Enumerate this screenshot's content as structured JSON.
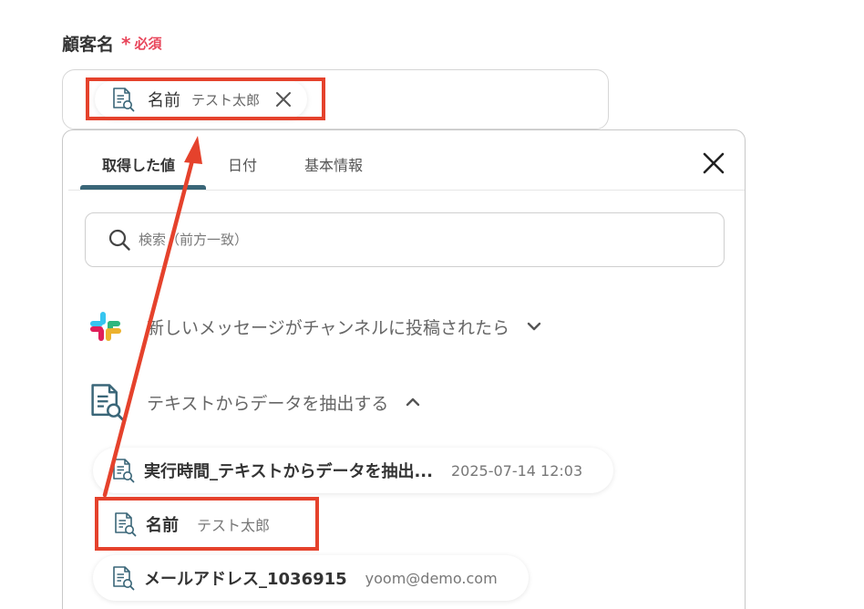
{
  "field": {
    "label": "顧客名",
    "required_star": "*",
    "required_text": "必須",
    "selected_chip": {
      "name": "名前",
      "value": "テスト太郎",
      "icon": "document-search-icon"
    }
  },
  "panel": {
    "tabs": [
      {
        "label": "取得した値",
        "active": true
      },
      {
        "label": "日付",
        "active": false
      },
      {
        "label": "基本情報",
        "active": false
      }
    ],
    "search": {
      "placeholder": "検索（前方一致）"
    },
    "sections": [
      {
        "title": "新しいメッセージがチャンネルに投稿されたら",
        "icon": "slack-icon",
        "expanded": false
      },
      {
        "title": "テキストからデータを抽出する",
        "icon": "document-search-icon",
        "expanded": true
      }
    ],
    "items": [
      {
        "name": "実行時間_テキストからデータを抽出...",
        "value": "2025-07-14 12:03"
      },
      {
        "name": "名前",
        "value": "テスト太郎"
      },
      {
        "name": "メールアドレス_1036915",
        "value": "yoom@demo.com"
      }
    ]
  },
  "colors": {
    "accent": "#3a6678",
    "required": "#e8455a",
    "annotation": "#e5422c"
  }
}
